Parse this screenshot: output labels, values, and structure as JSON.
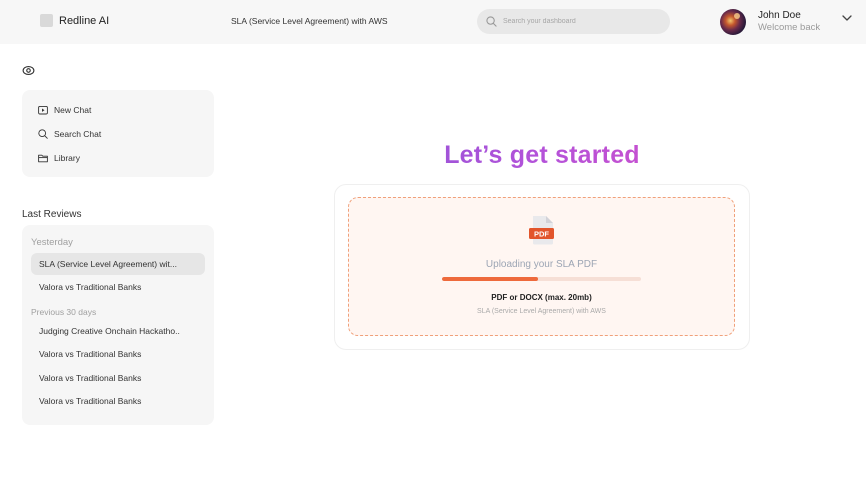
{
  "header": {
    "app_name": "Redline AI",
    "document_title": "SLA (Service Level Agreement) with AWS",
    "search_placeholder": "Search your dashboard",
    "user_name": "John Doe",
    "user_greeting": "Welcome back"
  },
  "sidebar": {
    "menu": [
      {
        "label": "New Chat",
        "icon": "new-chat-icon"
      },
      {
        "label": "Search Chat",
        "icon": "search-icon"
      },
      {
        "label": "Library",
        "icon": "library-icon"
      }
    ],
    "reviews_title": "Last Reviews",
    "groups": [
      {
        "label": "Yesterday",
        "items": [
          "SLA (Service Level Agreement) wit...",
          "Valora vs Traditional Banks"
        ]
      },
      {
        "label": "Previous 30 days",
        "items": [
          "Judging Creative Onchain Hackatho..",
          "Valora vs Traditional Banks",
          "Valora vs Traditional Banks",
          "Valora vs Traditional Banks"
        ]
      }
    ]
  },
  "main": {
    "heading": "Let’s get started",
    "upload": {
      "file_badge": "PDF",
      "status": "Uploading your SLA PDF",
      "progress_percent": 48,
      "formats": "PDF or DOCX (max. 20mb)",
      "file_name": "SLA (Service Level Agreement) with AWS"
    }
  },
  "colors": {
    "accent_orange": "#ee6a3c",
    "gradient_start": "#8d55d8",
    "gradient_end": "#d64fc8"
  }
}
